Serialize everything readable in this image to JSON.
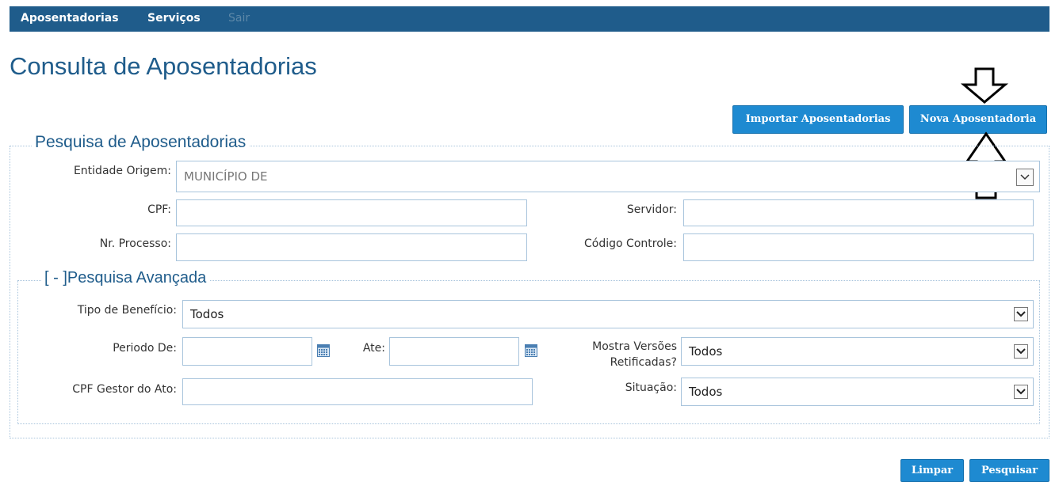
{
  "nav": {
    "items": [
      "Aposentadorias",
      "Serviços"
    ],
    "faded_item": "Sair"
  },
  "page_title": "Consulta de Aposentadorias",
  "buttons": {
    "import": "Importar Aposentadorias",
    "new": "Nova Aposentadoria",
    "clear": "Limpar",
    "search": "Pesquisar"
  },
  "search": {
    "legend": "Pesquisa de Aposentadorias",
    "entidade_label": "Entidade Origem:",
    "entidade_value": "MUNICÍPIO DE",
    "cpf_label": "CPF:",
    "servidor_label": "Servidor:",
    "processo_label": "Nr. Processo:",
    "codigo_label": "Código Controle:"
  },
  "advanced": {
    "legend": "[ - ]Pesquisa Avançada",
    "tipo_label": "Tipo de Benefício:",
    "tipo_value": "Todos",
    "periodo_label": "Periodo De:",
    "ate_label": "Ate:",
    "versoes_label_1": "Mostra Versões",
    "versoes_label_2": "Retificadas?",
    "versoes_value": "Todos",
    "gestor_label": "CPF Gestor do Ato:",
    "situacao_label": "Situação:",
    "situacao_value": "Todos"
  },
  "icons": {
    "dropdown": "chevron-down-icon",
    "calendar": "calendar-icon",
    "arrow": "outline-arrow-icon"
  }
}
